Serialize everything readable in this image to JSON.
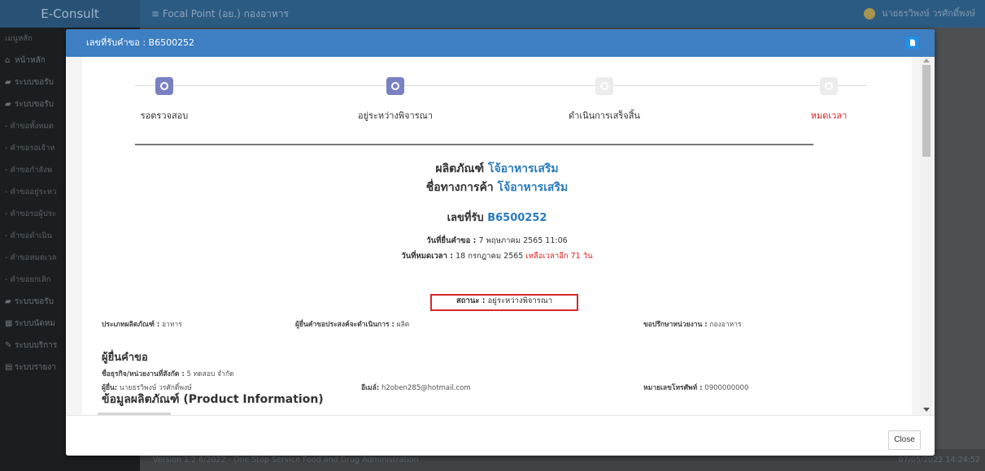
{
  "app": {
    "brand": "E-Consult",
    "breadcrumb": "≡  Focal Point (อย.) กองอาหาร",
    "user": "นายธรวิพงษ์ วรศักดิ์พงษ์",
    "sidebar": [
      {
        "label": "เมนูหลัก",
        "icon": ""
      },
      {
        "label": "หน้าหลัก",
        "icon": "home-icon"
      },
      {
        "label": "ระบบขอรับ",
        "icon": "book-icon"
      },
      {
        "label": "ระบบขอรับ",
        "icon": "book-icon"
      },
      {
        "label": "- คำขอทั้งหมด",
        "icon": ""
      },
      {
        "label": "- คำขอรอเจ้าห",
        "icon": ""
      },
      {
        "label": "- คำขอกำลังพ",
        "icon": ""
      },
      {
        "label": "- คำขออยู่ระหว",
        "icon": ""
      },
      {
        "label": "- คำขอรอผู้ประ",
        "icon": ""
      },
      {
        "label": "- คำขอดำเนิน",
        "icon": ""
      },
      {
        "label": "- คำขอหมดเวล",
        "icon": ""
      },
      {
        "label": "- คำขอยกเลิก",
        "icon": ""
      },
      {
        "label": "ระบบขอรับ",
        "icon": "book-icon"
      },
      {
        "label": "ระบบนัดหม",
        "icon": "calendar-icon"
      },
      {
        "label": "ระบบบริการ",
        "icon": "tools-icon"
      },
      {
        "label": "ระบบรายงา",
        "icon": "report-icon"
      }
    ],
    "footer_version": "Version 1.2 6/2022 - One Stop Service Food and Drug Administration",
    "footer_time": "07/05/2022 14:24:52"
  },
  "modal": {
    "title": "เลขที่รับคำขอ : B6500252",
    "close_label": "Close",
    "steps": [
      {
        "label": "รอตรวจสอบ",
        "state": "active"
      },
      {
        "label": "อยู่ระหว่างพิจารณา",
        "state": "active"
      },
      {
        "label": "ดำเนินการเสร็จสิ้น",
        "state": "inactive"
      },
      {
        "label": "หมดเวลา",
        "state": "inactive"
      }
    ],
    "product_prefix": "ผลิตภัณฑ์",
    "product_name": "โจ้อาหารเสริม",
    "trade_prefix": "ชื่อทางการค้า",
    "trade_name": "โจ้อาหารเสริม",
    "receipt_prefix": "เลขที่รับ",
    "receipt_no": "B6500252",
    "submit_label": "วันที่ยื่นคำขอ :",
    "submit_value": "7 พฤษภาคม 2565 11:06",
    "expire_label": "วันที่หมดเวลา :",
    "expire_value": "18 กรกฎาคม 2565",
    "remaining": "เหลือเวลาอีก 71 วัน",
    "status_label": "สถานะ :",
    "status_value": "อยู่ระหว่างพิจารณา",
    "product_type_label": "ประเภทผลิตภัณฑ์ :",
    "product_type_value": "อาหาร",
    "purpose_label": "ผู้ยื่นคำขอประสงค์จะดำเนินการ :",
    "purpose_value": "ผลิต",
    "consult_label": "ขอปรึกษาหน่วยงาน :",
    "consult_value": "กองอาหาร",
    "applicant_heading": "ผู้ยื่นคำขอ",
    "company_label": "ชื่อธุรกิจ/หน่วยงานที่สังกัด :",
    "company_value": "5 ทดสอบ จำกัด",
    "applicant_label": "ผู้ยื่น:",
    "applicant_value": "นายธรวิพงษ์ วรศักดิ์พงษ์",
    "email_label": "อีเมล์:",
    "email_value": "h2oben285@hotmail.com",
    "phone_label": "หมายเลขโทรศัพท์ :",
    "phone_value": "0900000000",
    "product_info_heading": "ข้อมูลผลิตภัณฑ์ (Product Information)"
  },
  "colors": {
    "modal_header": "#3d7fc2",
    "step_active": "#7a81c3",
    "step_inactive": "#ececec",
    "link_blue": "#2a7bbd",
    "alert_red": "#e02020",
    "status_box_border": "#d9262c"
  }
}
